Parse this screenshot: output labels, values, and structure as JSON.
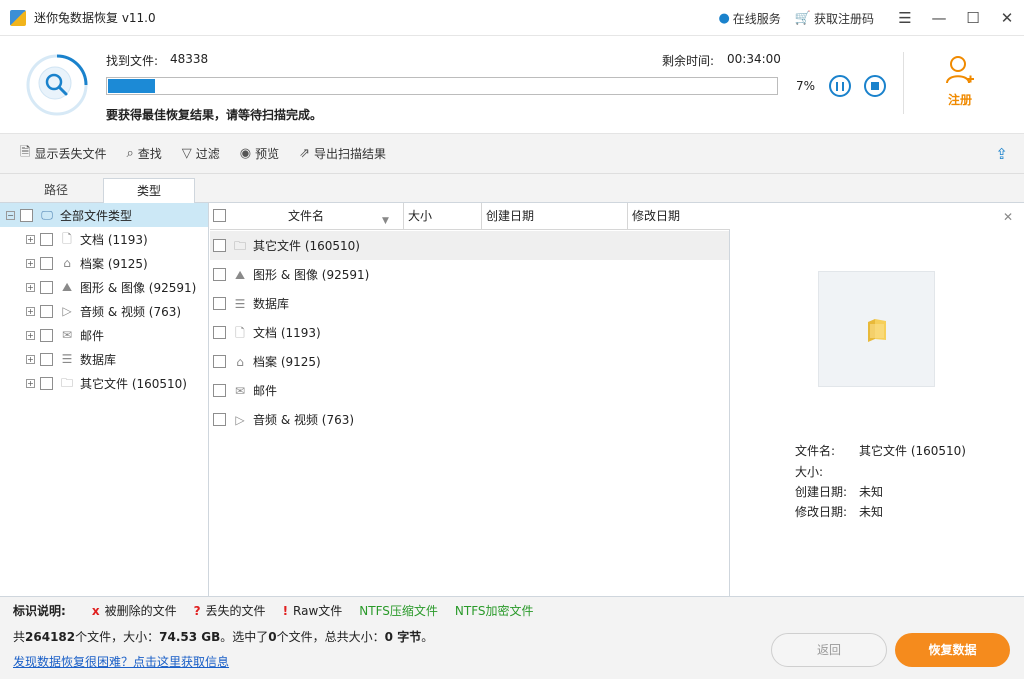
{
  "window": {
    "title": "迷你兔数据恢复 v11.0",
    "online_service": "在线服务",
    "get_code": "获取注册码"
  },
  "scan": {
    "found_label": "找到文件:",
    "found_value": "48338",
    "remaining_label": "剩余时间:",
    "remaining_value": "00:34:00",
    "progress_percent": 7,
    "percent_text": "7%",
    "hint": "要获得最佳恢复结果，请等待扫描完成。",
    "register_label": "注册"
  },
  "toolbar": {
    "show_lost": "显示丢失文件",
    "find": "查找",
    "filter": "过滤",
    "preview": "预览",
    "export": "导出扫描结果"
  },
  "tabs": {
    "path": "路径",
    "type": "类型"
  },
  "tree": {
    "root": "全部文件类型",
    "items": [
      {
        "label": "文档 (1193)",
        "icon": "document-icon"
      },
      {
        "label": "档案 (9125)",
        "icon": "archive-icon"
      },
      {
        "label": "图形 & 图像 (92591)",
        "icon": "image-icon"
      },
      {
        "label": "音频 & 视频 (763)",
        "icon": "media-icon"
      },
      {
        "label": "邮件",
        "icon": "mail-icon"
      },
      {
        "label": "数据库",
        "icon": "database-icon"
      },
      {
        "label": "其它文件 (160510)",
        "icon": "folder-icon"
      }
    ]
  },
  "list": {
    "columns": [
      "文件名",
      "大小",
      "创建日期",
      "修改日期"
    ],
    "rows": [
      {
        "label": "其它文件 (160510)",
        "icon": "folder-icon"
      },
      {
        "label": "图形 & 图像 (92591)",
        "icon": "image-icon"
      },
      {
        "label": "数据库",
        "icon": "database-icon"
      },
      {
        "label": "文档 (1193)",
        "icon": "document-icon"
      },
      {
        "label": "档案 (9125)",
        "icon": "archive-icon"
      },
      {
        "label": "邮件",
        "icon": "mail-icon"
      },
      {
        "label": "音频 & 视频 (763)",
        "icon": "media-icon"
      }
    ]
  },
  "preview": {
    "filename_label": "文件名:",
    "filename_value": "其它文件 (160510)",
    "size_label": "大小:",
    "size_value": "",
    "created_label": "创建日期:",
    "created_value": "未知",
    "modified_label": "修改日期:",
    "modified_value": "未知"
  },
  "legend": {
    "title": "标识说明:",
    "items": [
      {
        "mark": "x",
        "text": "被删除的文件",
        "color": "#e02020",
        "text_color": "#222222"
      },
      {
        "mark": "?",
        "text": "丢失的文件",
        "color": "#e02020",
        "text_color": "#222222"
      },
      {
        "mark": "!",
        "text": "Raw文件",
        "color": "#e02020",
        "text_color": "#222222"
      },
      {
        "mark": "",
        "text": "NTFS压缩文件",
        "color": "#2a9a2a",
        "text_color": "#2a9a2a"
      },
      {
        "mark": "",
        "text": "NTFS加密文件",
        "color": "#2a9a2a",
        "text_color": "#2a9a2a"
      }
    ]
  },
  "status": {
    "total_prefix": "共",
    "total_count": "264182",
    "total_mid": "个文件，大小：",
    "total_size": "74.53 GB",
    "selected_prefix": "。选中了",
    "selected_count": "0",
    "selected_mid": "个文件，总共大小：",
    "selected_size": "0 字节",
    "selected_suffix": "。",
    "help_link": "发现数据恢复很困难？点击这里获取信息",
    "back": "返回",
    "recover": "恢复数据"
  },
  "colors": {
    "accent": "#1a82cc",
    "progress": "#1c8ad6",
    "orange": "#f58b1d",
    "tree_selected": "#cce8f6"
  }
}
